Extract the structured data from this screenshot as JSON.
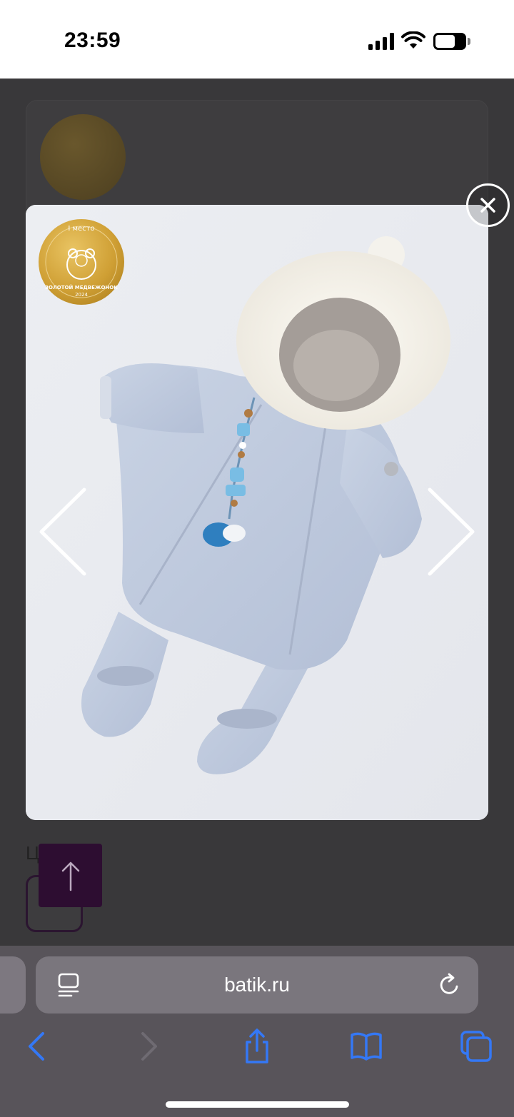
{
  "status_bar": {
    "time": "23:59",
    "battery_level": "27",
    "icons": [
      "signal-icon",
      "wifi-icon",
      "battery-icon"
    ]
  },
  "background_page": {
    "section_label": "Ц",
    "badge_icon": "award-badge-icon",
    "scroll_top_icon": "arrow-up-icon"
  },
  "lightbox": {
    "image_subject": "product-photo-snowsuit",
    "badge": {
      "place": "I место",
      "award": "ЗОЛОТОЙ МЕДВЕЖОНОК",
      "year": "2024"
    },
    "close_icon": "close-icon",
    "prev_icon": "chevron-left-icon",
    "next_icon": "chevron-right-icon"
  },
  "browser": {
    "url": "batik.ru",
    "page_menu_icon": "page-menu-icon",
    "reload_icon": "reload-icon",
    "toolbar": [
      "back-icon",
      "forward-icon",
      "share-icon",
      "bookmarks-icon",
      "tabs-icon"
    ]
  },
  "colors": {
    "accent": "#3478f6",
    "overlay": "#39383a",
    "scroll_button": "#2d0d31",
    "badge_gold": "#d4a83a"
  }
}
